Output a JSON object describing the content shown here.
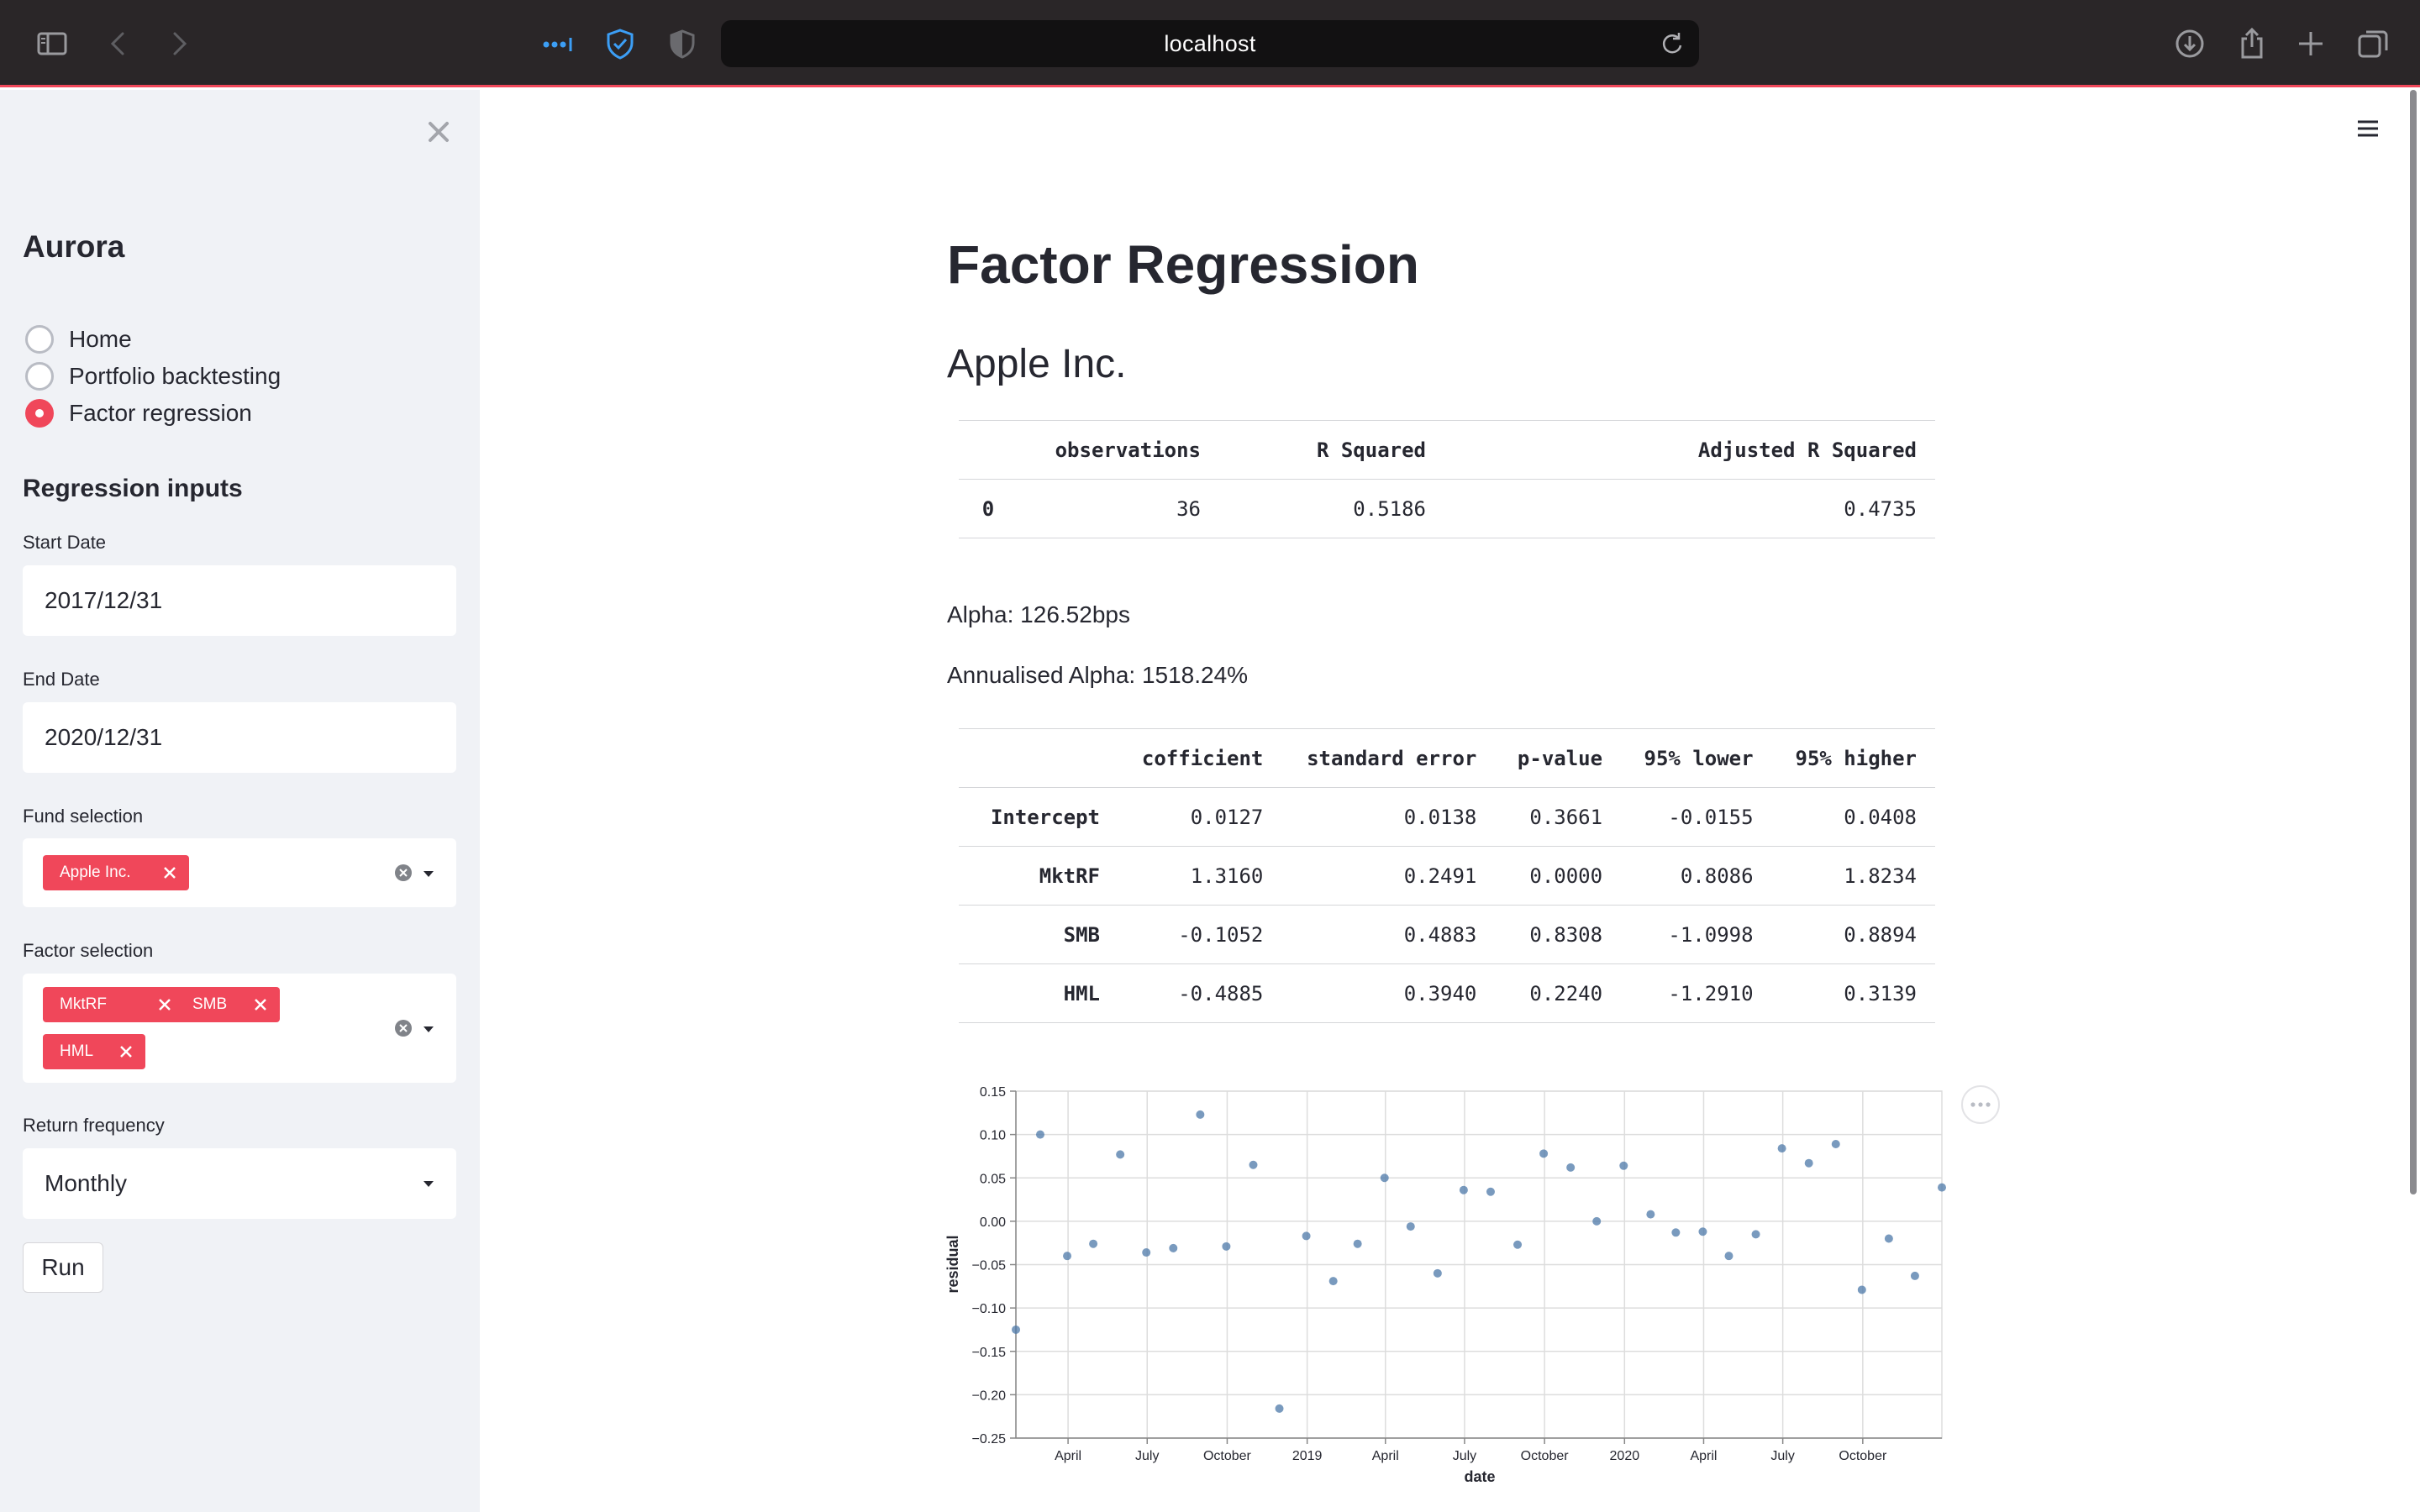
{
  "browser": {
    "url": "localhost"
  },
  "sidebar": {
    "app_title": "Aurora",
    "nav": [
      {
        "label": "Home",
        "selected": false
      },
      {
        "label": "Portfolio backtesting",
        "selected": false
      },
      {
        "label": "Factor regression",
        "selected": true
      }
    ],
    "inputs_heading": "Regression inputs",
    "start_date": {
      "label": "Start Date",
      "value": "2017/12/31"
    },
    "end_date": {
      "label": "End Date",
      "value": "2020/12/31"
    },
    "fund_selection": {
      "label": "Fund selection",
      "tags": [
        "Apple Inc."
      ]
    },
    "factor_selection": {
      "label": "Factor selection",
      "tags": [
        "MktRF",
        "SMB",
        "HML"
      ]
    },
    "return_frequency": {
      "label": "Return frequency",
      "value": "Monthly"
    },
    "run_label": "Run"
  },
  "main": {
    "title": "Factor Regression",
    "fund_name": "Apple Inc.",
    "summary_table": {
      "columns": [
        "",
        "observations",
        "R Squared",
        "Adjusted R Squared"
      ],
      "rows": [
        [
          "0",
          "36",
          "0.5186",
          "0.4735"
        ]
      ]
    },
    "alpha_text": "Alpha: 126.52bps",
    "annualised_alpha_text": "Annualised Alpha: 1518.24%",
    "coef_table": {
      "columns": [
        "",
        "cofficient",
        "standard error",
        "p-value",
        "95% lower",
        "95% higher"
      ],
      "rows": [
        [
          "Intercept",
          "0.0127",
          "0.0138",
          "0.3661",
          "-0.0155",
          "0.0408"
        ],
        [
          "MktRF",
          "1.3160",
          "0.2491",
          "0.0000",
          "0.8086",
          "1.8234"
        ],
        [
          "SMB",
          "-0.1052",
          "0.4883",
          "0.8308",
          "-1.0998",
          "0.8894"
        ],
        [
          "HML",
          "-0.4885",
          "0.3940",
          "0.2240",
          "-1.2910",
          "0.3139"
        ]
      ]
    }
  },
  "chart_data": {
    "type": "scatter",
    "xlabel": "date",
    "ylabel": "residual",
    "ylim": [
      -0.25,
      0.15
    ],
    "yticks": [
      "0.15",
      "0.10",
      "0.05",
      "0.00",
      "−0.05",
      "−0.10",
      "−0.15",
      "−0.20",
      "−0.25"
    ],
    "xticks": [
      "April",
      "July",
      "October",
      "2019",
      "April",
      "July",
      "October",
      "2020",
      "April",
      "July",
      "October"
    ],
    "grid": true,
    "point_color": "#4c78a8",
    "points": [
      {
        "x": "2018-01-31",
        "y": -0.125
      },
      {
        "x": "2018-02-28",
        "y": 0.1
      },
      {
        "x": "2018-03-31",
        "y": -0.04
      },
      {
        "x": "2018-04-30",
        "y": -0.026
      },
      {
        "x": "2018-05-31",
        "y": 0.077
      },
      {
        "x": "2018-06-30",
        "y": -0.036
      },
      {
        "x": "2018-07-31",
        "y": -0.031
      },
      {
        "x": "2018-08-31",
        "y": 0.123
      },
      {
        "x": "2018-09-30",
        "y": -0.029
      },
      {
        "x": "2018-10-31",
        "y": 0.065
      },
      {
        "x": "2018-11-30",
        "y": -0.216
      },
      {
        "x": "2018-12-31",
        "y": -0.017
      },
      {
        "x": "2019-01-31",
        "y": -0.069
      },
      {
        "x": "2019-02-28",
        "y": -0.026
      },
      {
        "x": "2019-03-31",
        "y": 0.05
      },
      {
        "x": "2019-04-30",
        "y": -0.006
      },
      {
        "x": "2019-05-31",
        "y": -0.06
      },
      {
        "x": "2019-06-30",
        "y": 0.036
      },
      {
        "x": "2019-07-31",
        "y": 0.034
      },
      {
        "x": "2019-08-31",
        "y": -0.027
      },
      {
        "x": "2019-09-30",
        "y": 0.078
      },
      {
        "x": "2019-10-31",
        "y": 0.062
      },
      {
        "x": "2019-11-30",
        "y": 0.0
      },
      {
        "x": "2019-12-31",
        "y": 0.064
      },
      {
        "x": "2020-01-31",
        "y": 0.008
      },
      {
        "x": "2020-02-29",
        "y": -0.013
      },
      {
        "x": "2020-03-31",
        "y": -0.012
      },
      {
        "x": "2020-04-30",
        "y": -0.04
      },
      {
        "x": "2020-05-31",
        "y": -0.015
      },
      {
        "x": "2020-06-30",
        "y": 0.084
      },
      {
        "x": "2020-07-31",
        "y": 0.067
      },
      {
        "x": "2020-08-31",
        "y": 0.089
      },
      {
        "x": "2020-09-30",
        "y": -0.079
      },
      {
        "x": "2020-10-31",
        "y": -0.02
      },
      {
        "x": "2020-11-30",
        "y": -0.063
      },
      {
        "x": "2020-12-31",
        "y": 0.039
      }
    ]
  }
}
